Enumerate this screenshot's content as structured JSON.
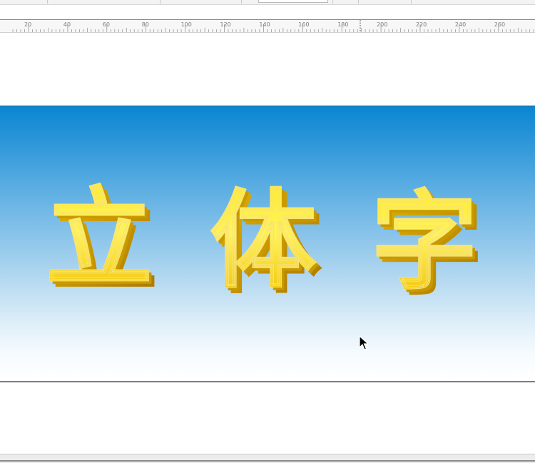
{
  "ruler": {
    "labels": [
      "20",
      "40",
      "60",
      "80",
      "100",
      "120",
      "140",
      "160",
      "180",
      "200",
      "220",
      "240",
      "260"
    ]
  },
  "banner": {
    "text": "立体字",
    "char_1": "立",
    "char_2": "体",
    "char_3": "字",
    "colors": {
      "sky_top": "#0a86d2",
      "sky_bottom": "#ffffff",
      "gold_light": "#fff35c",
      "gold_mid": "#f5d60a",
      "gold_dark": "#b8860b"
    }
  },
  "icons": {
    "cursor": "mouse-pointer-icon"
  }
}
